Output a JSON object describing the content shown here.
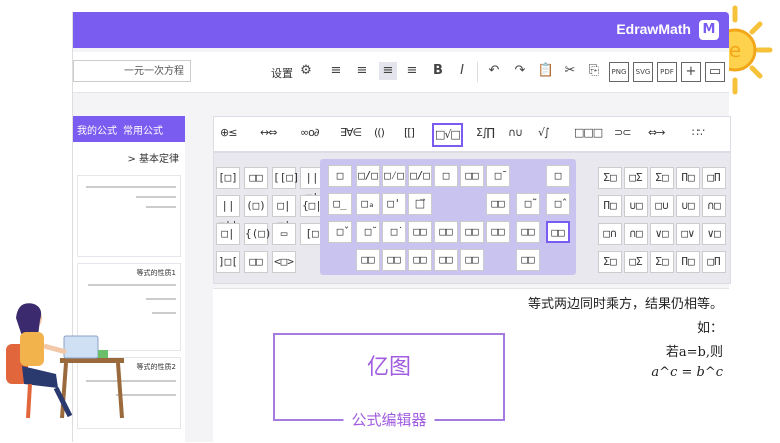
{
  "app": {
    "title": "EdrawMath",
    "logo_char": "M"
  },
  "toolbar": {
    "search_value": "一元一次方程",
    "settings_label": "设置",
    "buttons": [
      "≡",
      "≡",
      "≡",
      "≡",
      "B",
      "I",
      "↶",
      "↷",
      "✂",
      "⎘",
      "⎗",
      "PNG",
      "SVG",
      "PDF",
      "+",
      "▭"
    ]
  },
  "left": {
    "tabs": [
      "常用公式",
      "我的公式"
    ],
    "section": "> 基本定律",
    "card_titles": [
      "",
      "",
      "等式的性质1",
      "等式的性质2"
    ]
  },
  "symbol_tabs": [
    "⊕≤",
    "↔⇔",
    "∞ο∂",
    "∃∀∈",
    "(()",
    "[[]",
    "□√□",
    "Σ∫∏",
    "∩∪",
    "√∫",
    "□□□",
    "⊃⊂",
    "⇔→",
    "∷∵"
  ],
  "symbol_tab_active_index": 9,
  "palette": {
    "left_cells": [
      "[□]",
      "□□",
      "[[□]",
      "||□|",
      "||□||",
      "(□)",
      "□|□|",
      "{□|",
      "□|",
      "{(□)}",
      "▭",
      "[□",
      "]□[",
      "□□",
      "<□>"
    ],
    "mid_cells": [
      "□",
      "□/□",
      "□⁄□",
      "□/□",
      "□",
      "□□",
      "□̄",
      "□̲",
      "□ₐ",
      "□'",
      "□⃗",
      "□□",
      "□̃",
      "□̂",
      "□̌",
      "□̆",
      "□̇",
      "□□",
      "□□",
      "□□",
      "□□",
      "□□",
      "□□",
      "□□",
      "□□",
      "□□",
      "□□",
      "□□",
      "□□"
    ],
    "right_cells": [
      "Σ□",
      "□Σ",
      "Σ□",
      "Π□",
      "□Π",
      "Π□",
      "∪□",
      "□∪",
      "∪□",
      "∩□",
      "□∩",
      "∩□",
      "∨□",
      "□∨",
      "∨□"
    ]
  },
  "editor": {
    "lines": [
      "等式两边同时乘方，结果仍相等。",
      "如：",
      "若a=b,则",
      "a^c = b^c"
    ]
  },
  "promo": {
    "big": "亿图",
    "sub": "公式编辑器"
  }
}
